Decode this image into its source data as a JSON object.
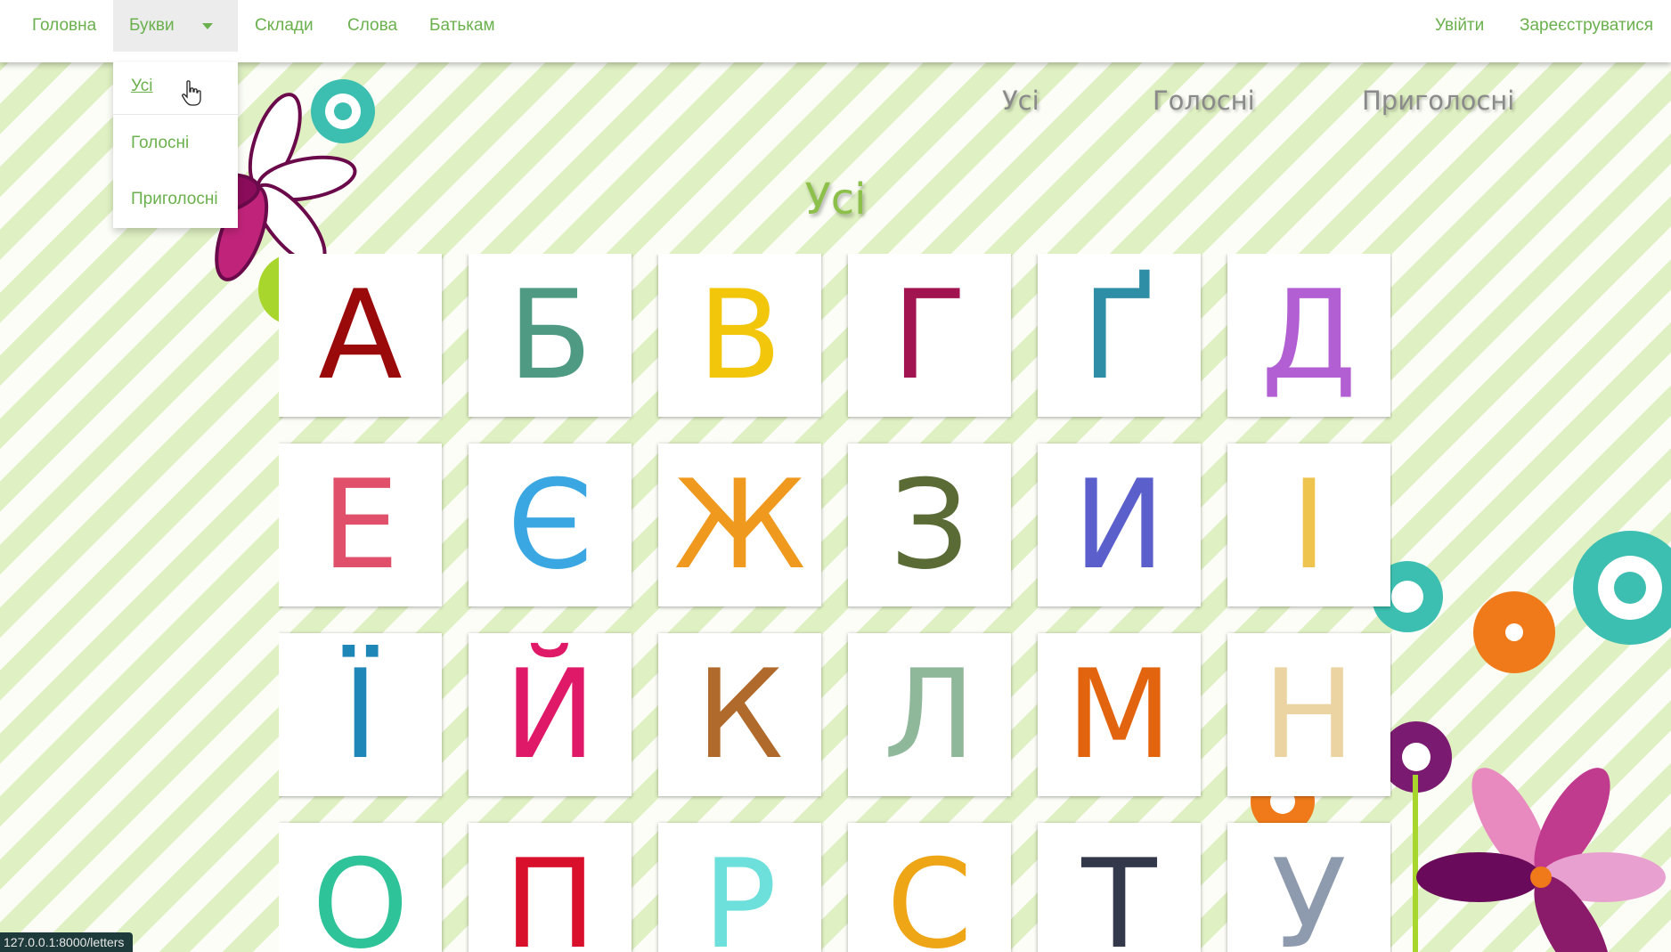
{
  "navbar": {
    "items": [
      {
        "label": "Головна"
      },
      {
        "label": "Букви"
      },
      {
        "label": "Склади"
      },
      {
        "label": "Слова"
      },
      {
        "label": "Батькам"
      }
    ],
    "right": [
      {
        "label": "Увійти"
      },
      {
        "label": "Зареєструватися"
      }
    ]
  },
  "dropdown": {
    "items": [
      {
        "label": "Усі"
      },
      {
        "label": "Голосні"
      },
      {
        "label": "Приголосні"
      }
    ]
  },
  "subnav": {
    "items": [
      {
        "label": "Усі"
      },
      {
        "label": "Голосні"
      },
      {
        "label": "Приголосні"
      }
    ]
  },
  "page": {
    "title": "Усі"
  },
  "letters": [
    {
      "char": "А",
      "color": "#9b0a0a"
    },
    {
      "char": "Б",
      "color": "#4f9a82"
    },
    {
      "char": "В",
      "color": "#f2c60a"
    },
    {
      "char": "Г",
      "color": "#a11450"
    },
    {
      "char": "Ґ",
      "color": "#2e8ea6"
    },
    {
      "char": "Д",
      "color": "#b25fd3"
    },
    {
      "char": "Е",
      "color": "#e0506a"
    },
    {
      "char": "Є",
      "color": "#3aa7e2"
    },
    {
      "char": "Ж",
      "color": "#ef9a1e"
    },
    {
      "char": "З",
      "color": "#5a6b36"
    },
    {
      "char": "И",
      "color": "#5a5fcc"
    },
    {
      "char": "І",
      "color": "#efc44e"
    },
    {
      "char": "Ї",
      "color": "#1f86b8"
    },
    {
      "char": "Й",
      "color": "#e01868"
    },
    {
      "char": "К",
      "color": "#b06a2c"
    },
    {
      "char": "Л",
      "color": "#8fb79a"
    },
    {
      "char": "М",
      "color": "#e2640e"
    },
    {
      "char": "Н",
      "color": "#ecd3a2"
    },
    {
      "char": "О",
      "color": "#2ec398"
    },
    {
      "char": "П",
      "color": "#d8102c"
    },
    {
      "char": "Р",
      "color": "#6ee0dc"
    },
    {
      "char": "С",
      "color": "#eea616"
    },
    {
      "char": "Т",
      "color": "#33384a"
    },
    {
      "char": "У",
      "color": "#8e9aae"
    }
  ],
  "statusbar": {
    "url": "127.0.0.1:8000/letters"
  },
  "colors": {
    "accent": "#6ab04c",
    "title": "#8cc04a"
  }
}
